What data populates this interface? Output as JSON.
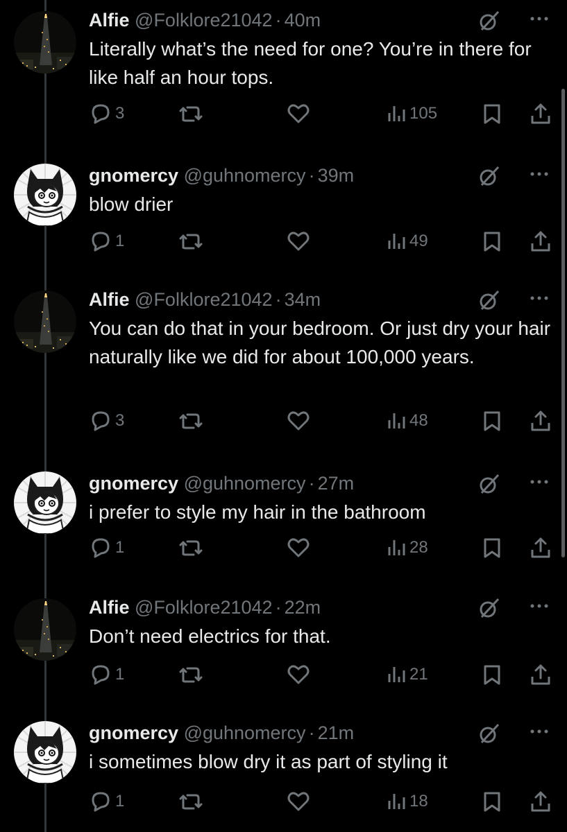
{
  "tweets": [
    {
      "author": "Alfie",
      "handle": "@Folklore21042",
      "separator": "·",
      "time": "40m",
      "text": "Literally what’s the need for one? You’re in there for like half an hour tops.",
      "replies": "3",
      "views": "105",
      "avatar": "city-tower-night"
    },
    {
      "author": "gnomercy",
      "handle": "@guhnomercy",
      "separator": "·",
      "time": "39m",
      "text": "blow drier",
      "replies": "1",
      "views": "49",
      "avatar": "cartoon-cat-girl"
    },
    {
      "author": "Alfie",
      "handle": "@Folklore21042",
      "separator": "·",
      "time": "34m",
      "text": "You can do that in your bedroom. Or just dry your hair naturally like we did for about 100,000 years.",
      "replies": "3",
      "views": "48",
      "avatar": "city-tower-night"
    },
    {
      "author": "gnomercy",
      "handle": "@guhnomercy",
      "separator": "·",
      "time": "27m",
      "text": "i prefer to style my hair in the bathroom",
      "replies": "1",
      "views": "28",
      "avatar": "cartoon-cat-girl"
    },
    {
      "author": "Alfie",
      "handle": "@Folklore21042",
      "separator": "·",
      "time": "22m",
      "text": "Don’t need electrics for that.",
      "replies": "1",
      "views": "21",
      "avatar": "city-tower-night"
    },
    {
      "author": "gnomercy",
      "handle": "@guhnomercy",
      "separator": "·",
      "time": "21m",
      "text": "i sometimes blow dry it as part of styling it",
      "replies": "1",
      "views": "18",
      "avatar": "cartoon-cat-girl"
    }
  ],
  "colors": {
    "background": "#000000",
    "text": "#e7e9ea",
    "muted": "#71767b",
    "thread_line": "#333639"
  },
  "icons": [
    "reply-icon",
    "retweet-icon",
    "like-icon",
    "views-icon",
    "bookmark-icon",
    "share-icon",
    "grok-icon",
    "more-icon"
  ]
}
